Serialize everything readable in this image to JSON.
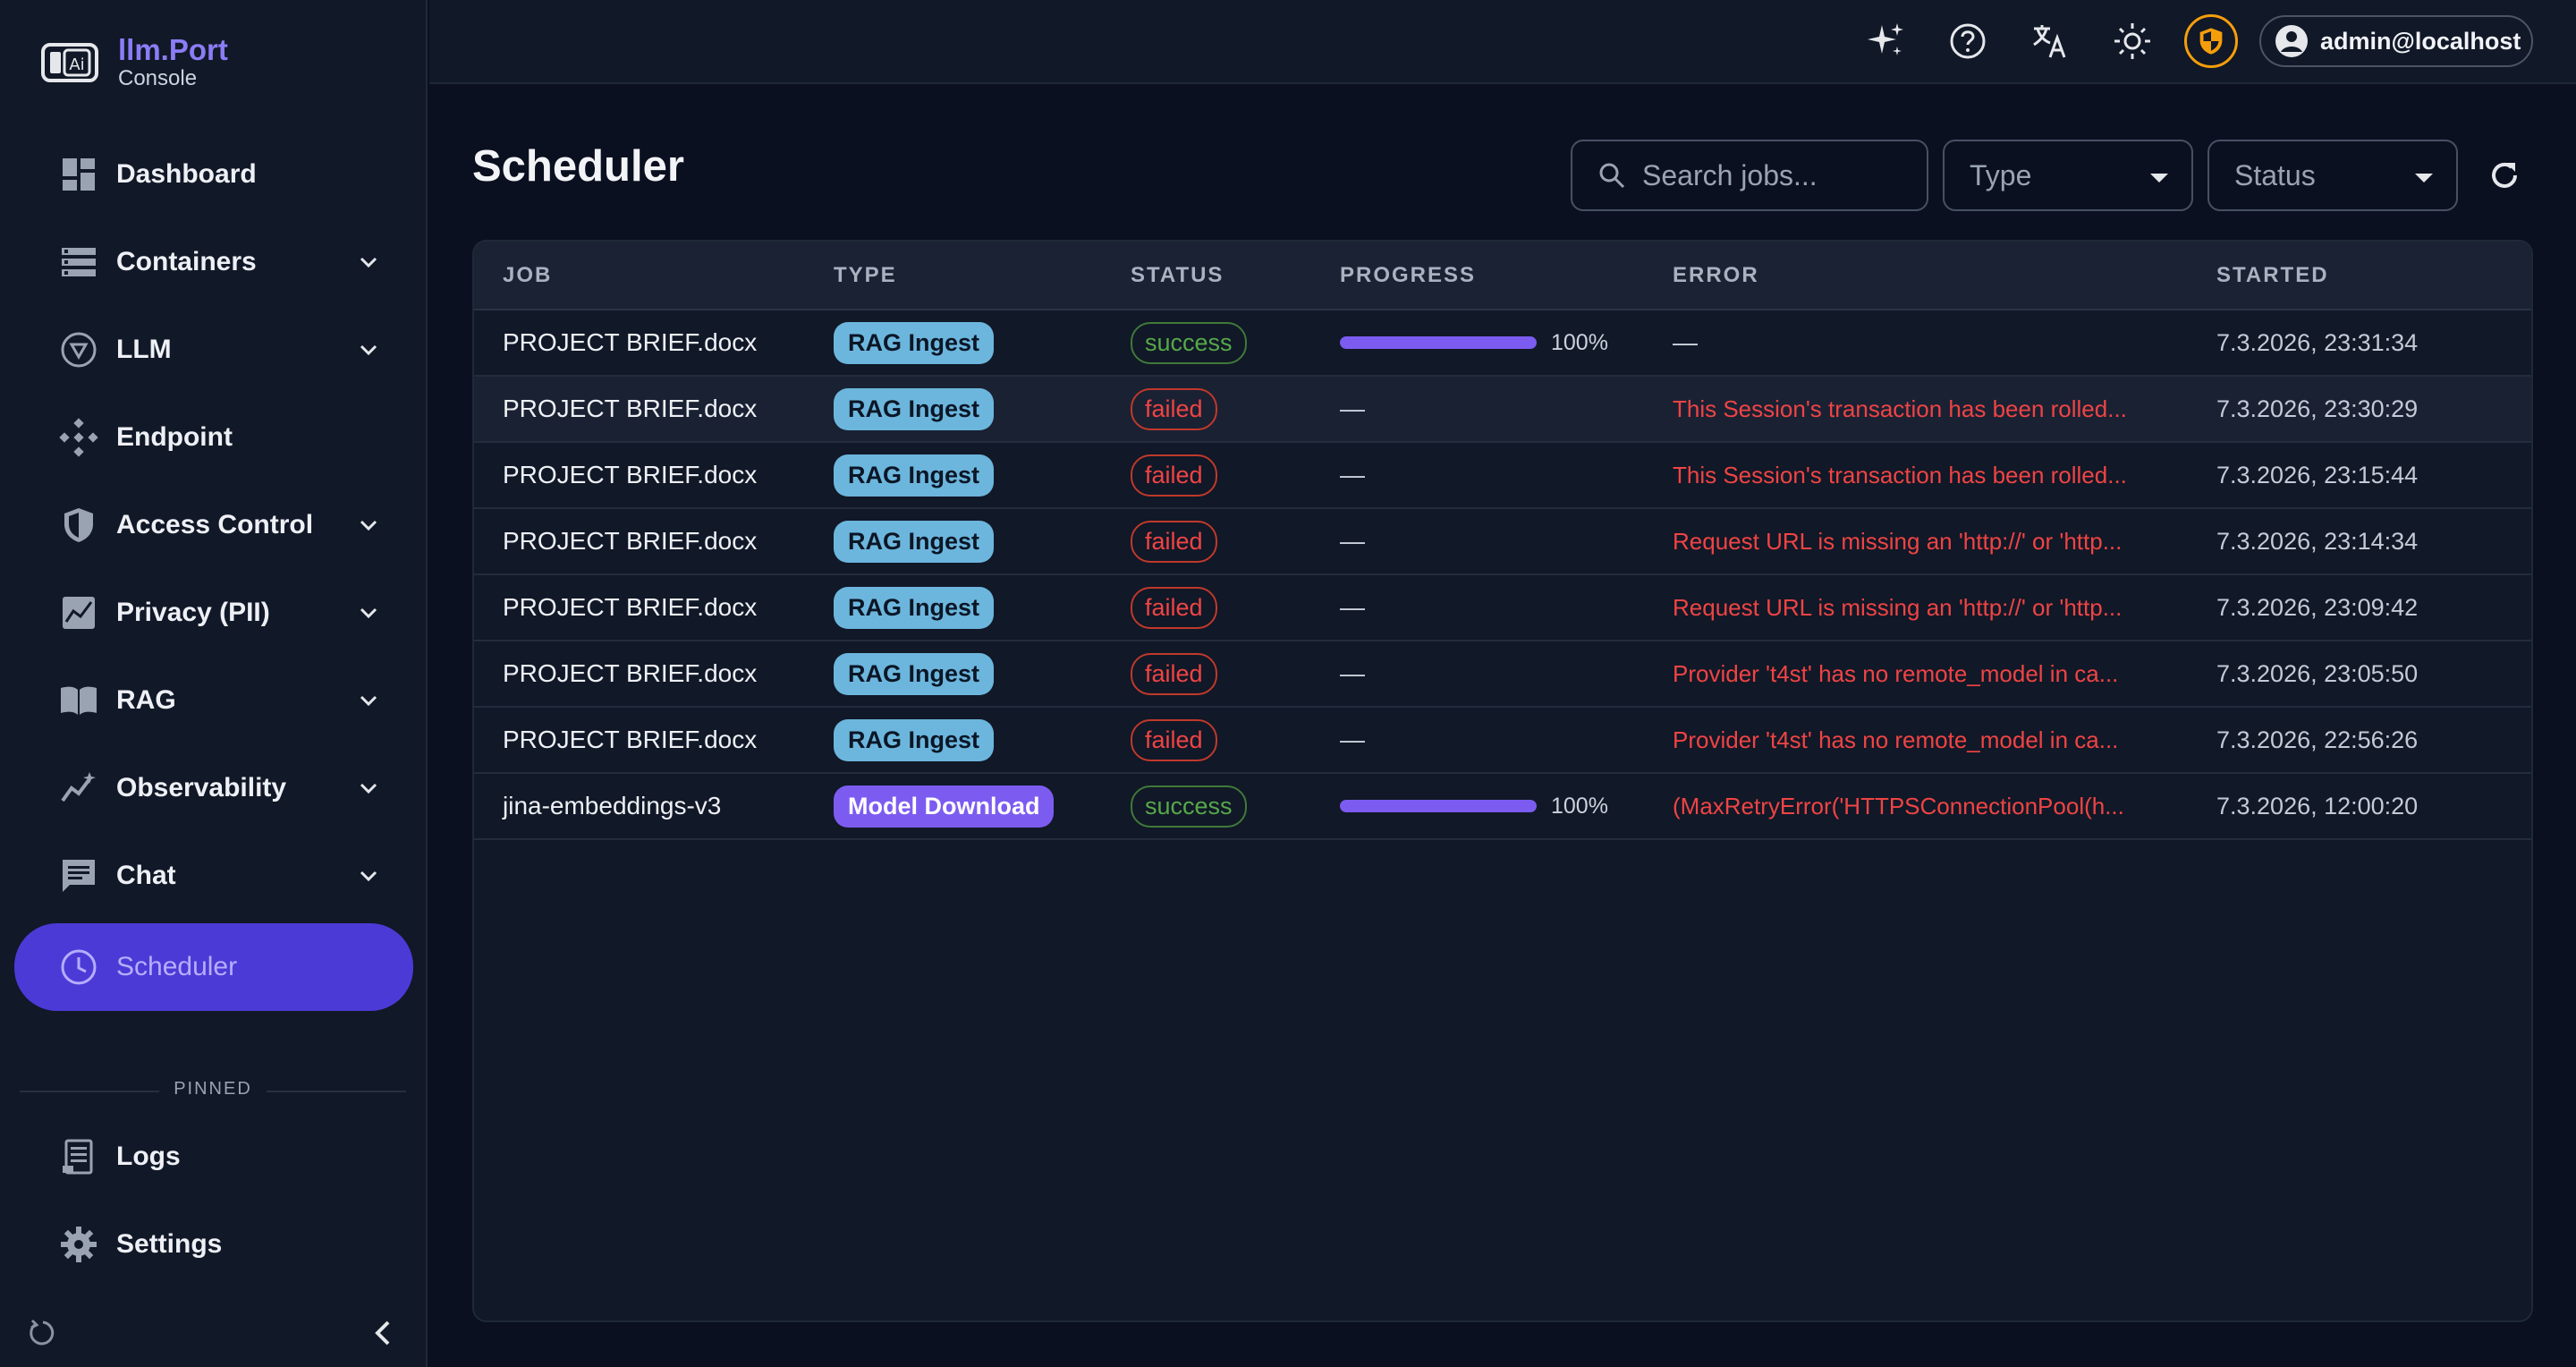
{
  "brand": {
    "name": "llm.Port",
    "subtitle": "Console"
  },
  "sidebar": {
    "items": [
      {
        "label": "Dashboard",
        "icon": "dashboard-icon",
        "expandable": false
      },
      {
        "label": "Containers",
        "icon": "containers-icon",
        "expandable": true
      },
      {
        "label": "LLM",
        "icon": "llm-icon",
        "expandable": true
      },
      {
        "label": "Endpoint",
        "icon": "endpoint-icon",
        "expandable": false
      },
      {
        "label": "Access Control",
        "icon": "shield-icon",
        "expandable": true
      },
      {
        "label": "Privacy (PII)",
        "icon": "privacy-chart-icon",
        "expandable": true
      },
      {
        "label": "RAG",
        "icon": "book-icon",
        "expandable": true
      },
      {
        "label": "Observability",
        "icon": "observability-icon",
        "expandable": true
      },
      {
        "label": "Chat",
        "icon": "chat-icon",
        "expandable": true
      },
      {
        "label": "Scheduler",
        "icon": "clock-icon",
        "expandable": false,
        "active": true
      }
    ],
    "pinned_label": "PINNED",
    "pinned": [
      {
        "label": "Logs",
        "icon": "logs-icon"
      },
      {
        "label": "Settings",
        "icon": "gear-icon"
      }
    ]
  },
  "topbar": {
    "user": "admin@localhost",
    "icons": [
      "sparkle-icon",
      "help-icon",
      "translate-icon",
      "theme-sun-icon",
      "security-shield-icon"
    ]
  },
  "main": {
    "title": "Scheduler",
    "search_placeholder": "Search jobs...",
    "type_filter": "Type",
    "status_filter": "Status"
  },
  "table": {
    "headers": [
      "JOB",
      "TYPE",
      "STATUS",
      "PROGRESS",
      "ERROR",
      "STARTED"
    ],
    "rows": [
      {
        "job": "PROJECT BRIEF.docx",
        "type": "RAG Ingest",
        "status": "success",
        "progress": "100%",
        "progress_value": 1.0,
        "error": "—",
        "started": "7.3.2026, 23:31:34"
      },
      {
        "job": "PROJECT BRIEF.docx",
        "type": "RAG Ingest",
        "status": "failed",
        "progress": "—",
        "error": "This Session's transaction has been rolled...",
        "started": "7.3.2026, 23:30:29"
      },
      {
        "job": "PROJECT BRIEF.docx",
        "type": "RAG Ingest",
        "status": "failed",
        "progress": "—",
        "error": "This Session's transaction has been rolled...",
        "started": "7.3.2026, 23:15:44"
      },
      {
        "job": "PROJECT BRIEF.docx",
        "type": "RAG Ingest",
        "status": "failed",
        "progress": "—",
        "error": "Request URL is missing an 'http://' or 'http...",
        "started": "7.3.2026, 23:14:34"
      },
      {
        "job": "PROJECT BRIEF.docx",
        "type": "RAG Ingest",
        "status": "failed",
        "progress": "—",
        "error": "Request URL is missing an 'http://' or 'http...",
        "started": "7.3.2026, 23:09:42"
      },
      {
        "job": "PROJECT BRIEF.docx",
        "type": "RAG Ingest",
        "status": "failed",
        "progress": "—",
        "error": "Provider 't4st' has no remote_model in ca...",
        "started": "7.3.2026, 23:05:50"
      },
      {
        "job": "PROJECT BRIEF.docx",
        "type": "RAG Ingest",
        "status": "failed",
        "progress": "—",
        "error": "Provider 't4st' has no remote_model in ca...",
        "started": "7.3.2026, 22:56:26"
      },
      {
        "job": "jina-embeddings-v3",
        "type": "Model Download",
        "status": "success",
        "progress": "100%",
        "progress_value": 1.0,
        "error": "(MaxRetryError('HTTPSConnectionPool(h...",
        "started": "7.3.2026, 12:00:20"
      }
    ]
  },
  "colors": {
    "accent": "#4c3ad6",
    "brand": "#8b7cf6",
    "success": "#56a84a",
    "failed": "#ef4444",
    "rag_badge": "#6cb6dd",
    "download_badge": "#7c5cf0"
  }
}
